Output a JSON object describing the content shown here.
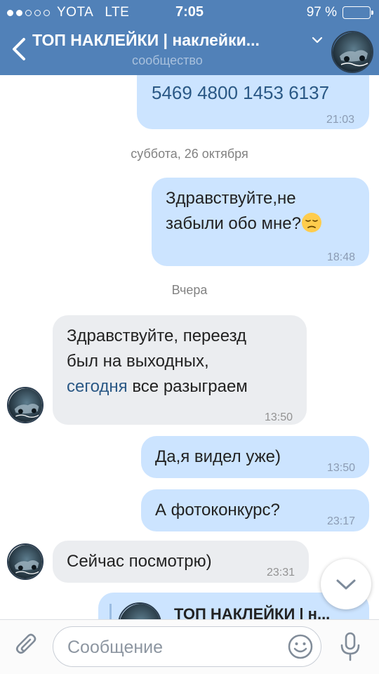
{
  "status_bar": {
    "carrier": "YOTA",
    "network": "LTE",
    "time": "7:05",
    "battery": "97 %",
    "battery_level": 0.97
  },
  "header": {
    "title": "ТОП НАКЛЕЙКИ | наклейки...",
    "subtitle": "сообщество"
  },
  "messages": [
    {
      "direction": "out",
      "text": "5469 4800 1453 6137",
      "time": "21:03"
    },
    {
      "type": "date",
      "text": "суббота, 26 октября"
    },
    {
      "direction": "out",
      "line1": "Здравствуйте,не",
      "line2": "забыли обо мне?",
      "emoji": "pensive-face",
      "time": "18:48"
    },
    {
      "type": "date",
      "text": "Вчера"
    },
    {
      "direction": "in",
      "line1": "Здравствуйте, переезд",
      "line2": "был на выходных,",
      "link": "сегодня",
      "line3_rest": " все разыграем",
      "time": "13:50"
    },
    {
      "direction": "out",
      "text": "Да,я видел уже)",
      "time": "13:50"
    },
    {
      "direction": "out",
      "text": "А фотоконкурс?",
      "time": "23:17"
    },
    {
      "direction": "in",
      "text": "Сейчас посмотрю)",
      "time": "23:31"
    },
    {
      "direction": "out",
      "type": "forwarded",
      "text": "ТОП НАКЛЕЙКИ | н..."
    }
  ],
  "input": {
    "placeholder": "Сообщение"
  },
  "colors": {
    "header_bg": "#5181b8",
    "outgoing_bubble": "#cce4ff",
    "incoming_bubble": "#ebedf0",
    "link": "#2a5885"
  },
  "icons": [
    "back-arrow-icon",
    "chevron-down-icon",
    "paperclip-icon",
    "smile-icon",
    "microphone-icon",
    "scroll-down-icon"
  ]
}
